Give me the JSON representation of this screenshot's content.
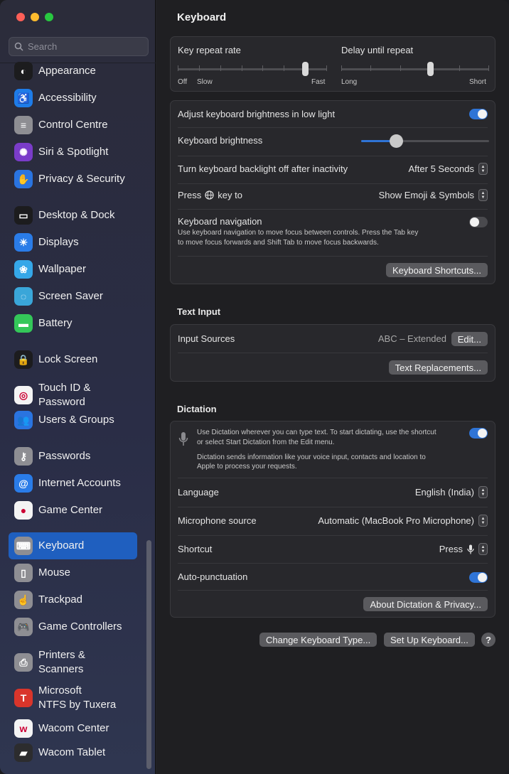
{
  "sidebar": {
    "search_placeholder": "Search",
    "items": [
      {
        "label": "Appearance",
        "icon": "appearance-icon",
        "color": "#1c1c1e"
      },
      {
        "label": "Accessibility",
        "icon": "accessibility-icon",
        "color": "#1e7ce8"
      },
      {
        "label": "Control Centre",
        "icon": "control-centre-icon",
        "color": "#8e8e93"
      },
      {
        "label": "Siri & Spotlight",
        "icon": "siri-icon",
        "color": "#7a3cc9"
      },
      {
        "label": "Privacy & Security",
        "icon": "hand-icon",
        "color": "#2a74e0"
      },
      {
        "label": "Desktop & Dock",
        "icon": "dock-icon",
        "color": "#1c1c1e"
      },
      {
        "label": "Displays",
        "icon": "sun-icon",
        "color": "#2a7ce8"
      },
      {
        "label": "Wallpaper",
        "icon": "wallpaper-icon",
        "color": "#35a7e8"
      },
      {
        "label": "Screen Saver",
        "icon": "screen-saver-icon",
        "color": "#3aa6d9"
      },
      {
        "label": "Battery",
        "icon": "battery-icon",
        "color": "#34c759"
      },
      {
        "label": "Lock Screen",
        "icon": "lock-icon",
        "color": "#1c1c1e"
      },
      {
        "label": "Touch ID &",
        "label2": "Password",
        "icon": "fingerprint-icon",
        "color": "#f4f4f4"
      },
      {
        "label": "Users & Groups",
        "icon": "users-icon",
        "color": "#2a74e0"
      },
      {
        "label": "Passwords",
        "icon": "key-icon",
        "color": "#8e8e93"
      },
      {
        "label": "Internet Accounts",
        "icon": "at-icon",
        "color": "#2a7ce8"
      },
      {
        "label": "Game Center",
        "icon": "game-center-icon",
        "color": "#f4f4f4"
      },
      {
        "label": "Keyboard",
        "icon": "keyboard-icon",
        "color": "#8e8e93"
      },
      {
        "label": "Mouse",
        "icon": "mouse-icon",
        "color": "#8e8e93"
      },
      {
        "label": "Trackpad",
        "icon": "trackpad-icon",
        "color": "#8e8e93"
      },
      {
        "label": "Game Controllers",
        "icon": "gamepad-icon",
        "color": "#8e8e93"
      },
      {
        "label": "Printers &",
        "label2": "Scanners",
        "icon": "printer-icon",
        "color": "#8e8e93"
      },
      {
        "label": "Microsoft",
        "label2": "NTFS by Tuxera",
        "icon": "tuxera-icon",
        "color": "#d9352b"
      },
      {
        "label": "Wacom Center",
        "icon": "wacom-center-icon",
        "color": "#f4f4f4"
      },
      {
        "label": "Wacom Tablet",
        "icon": "wacom-tablet-icon",
        "color": "#2c2c2e"
      }
    ]
  },
  "main": {
    "title": "Keyboard",
    "repeat": {
      "key_repeat_label": "Key repeat rate",
      "key_repeat_min1": "Off",
      "key_repeat_min2": "Slow",
      "key_repeat_max": "Fast",
      "key_repeat_value": 0.85,
      "delay_label": "Delay until repeat",
      "delay_min": "Long",
      "delay_max": "Short",
      "delay_value": 0.6
    },
    "brightness": {
      "adjust_label": "Adjust keyboard brightness in low light",
      "adjust_on": true,
      "brightness_label": "Keyboard brightness",
      "brightness_value": 0.27,
      "backlight_label": "Turn keyboard backlight off after inactivity",
      "backlight_value": "After 5 Seconds",
      "press_label_a": "Press",
      "press_label_b": "key to",
      "press_value": "Show Emoji & Symbols",
      "nav_label": "Keyboard navigation",
      "nav_desc1": "Use keyboard navigation to move focus between controls. Press the Tab key",
      "nav_desc2": "to move focus forwards and Shift Tab to move focus backwards.",
      "nav_on": false,
      "shortcuts_button": "Keyboard Shortcuts..."
    },
    "text_input": {
      "section": "Text Input",
      "sources_label": "Input Sources",
      "sources_value": "ABC – Extended",
      "edit_button": "Edit...",
      "replacements_button": "Text Replacements..."
    },
    "dictation": {
      "section": "Dictation",
      "desc1": "Use Dictation wherever you can type text. To start dictating, use the shortcut",
      "desc2": "or select Start Dictation from the Edit menu.",
      "desc3": "Dictation sends information like your voice input, contacts and location to",
      "desc4": "Apple to process your requests.",
      "dictation_on": true,
      "language_label": "Language",
      "language_value": "English (India)",
      "mic_label": "Microphone source",
      "mic_value": "Automatic (MacBook Pro Microphone)",
      "shortcut_label": "Shortcut",
      "shortcut_value": "Press",
      "autopunct_label": "Auto-punctuation",
      "autopunct_on": true,
      "about_button": "About Dictation & Privacy..."
    },
    "footer": {
      "change_type_button": "Change Keyboard Type...",
      "setup_button": "Set Up Keyboard...",
      "help": "?"
    }
  }
}
